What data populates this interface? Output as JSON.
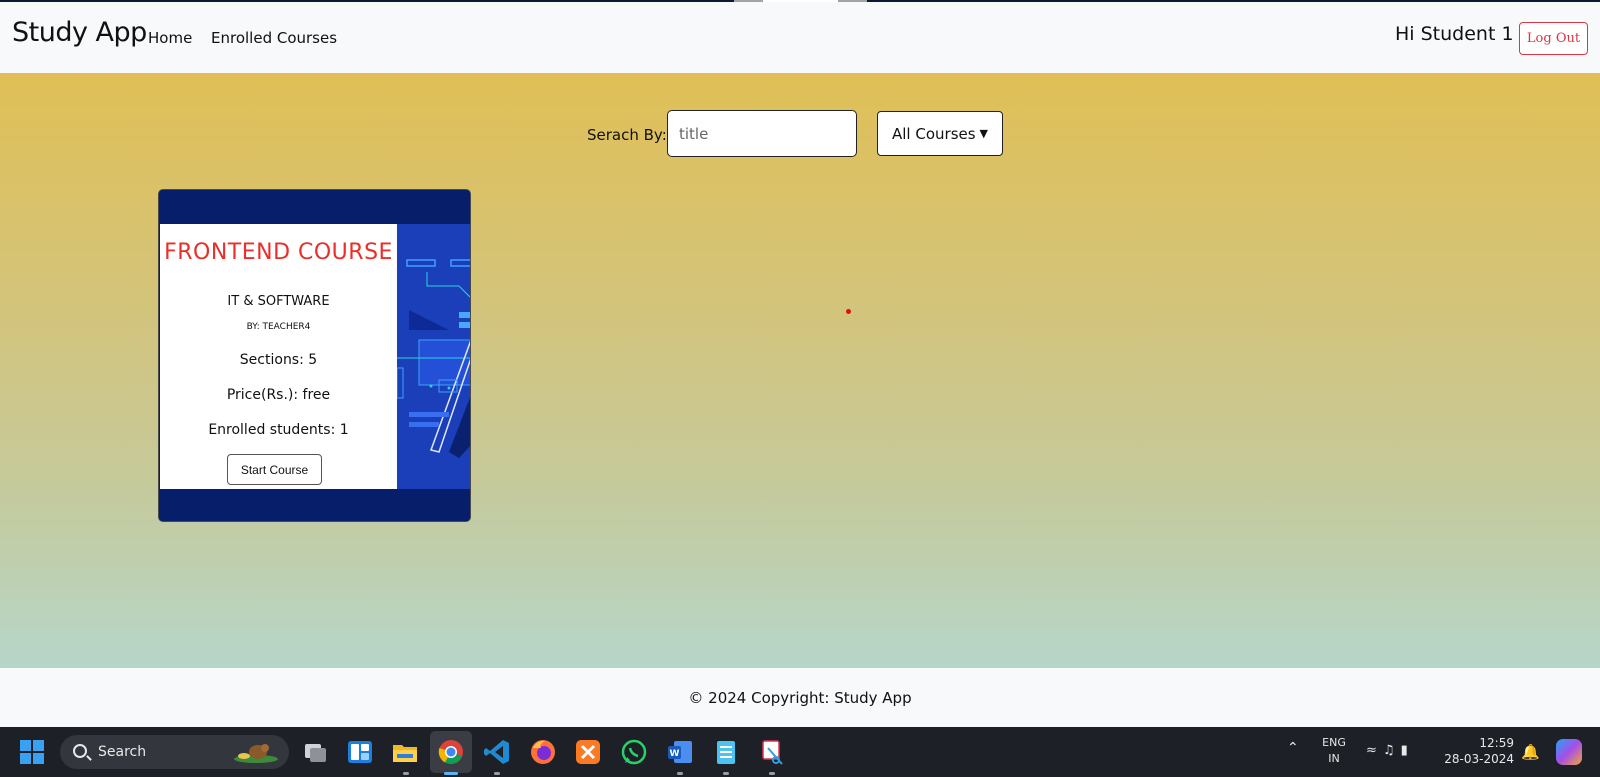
{
  "navbar": {
    "brand": "Study App",
    "links": [
      "Home",
      "Enrolled Courses"
    ],
    "greeting": "Hi Student 1",
    "logout_label": "Log Out"
  },
  "search": {
    "label": "Serach By:",
    "placeholder": "title",
    "filter_selected": "All Courses"
  },
  "courses": [
    {
      "title": "FRONTEND COURSE",
      "category": "IT & SOFTWARE",
      "by": "BY:  TEACHER4",
      "sections": "Sections: 5",
      "price": "Price(Rs.): free",
      "enrolled": "Enrolled students: 1",
      "button_label": "Start Course"
    }
  ],
  "footer": {
    "text": "© 2024 Copyright: Study App"
  },
  "taskbar": {
    "search_label": "Search",
    "language": "ENG",
    "region": "IN",
    "time": "12:59",
    "date": "28-03-2024",
    "apps": [
      "task-view",
      "widgets",
      "file-explorer",
      "chrome",
      "vscode",
      "firefox",
      "xampp",
      "whatsapp",
      "word",
      "notepad",
      "snipping-tool"
    ]
  },
  "colors": {
    "accent_red": "#dc3545",
    "card_bg": "#071e6b",
    "title_red": "#e8302a",
    "gradient_top": "#e0bf56",
    "gradient_bottom": "#b6d6c9"
  }
}
